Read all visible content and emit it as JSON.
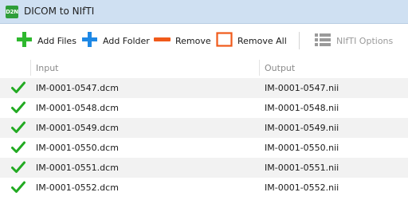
{
  "window": {
    "icon_text": "D2N",
    "title": "DICOM to NIfTI"
  },
  "toolbar": {
    "add_files_label": "Add Files",
    "add_folder_label": "Add Folder",
    "remove_label": "Remove",
    "remove_all_label": "Remove All",
    "nifti_options_label": "NIfTI Options",
    "colors": {
      "add": "#2eb82e",
      "folder": "#1e88e5",
      "remove": "#f05a1a",
      "disabled": "#9a9a9a"
    }
  },
  "list": {
    "columns": {
      "input": "Input",
      "output": "Output"
    },
    "status_icon": "check-icon",
    "status_color": "#22aa22",
    "rows": [
      {
        "input": "IM-0001-0547.dcm",
        "output": "IM-0001-0547.nii"
      },
      {
        "input": "IM-0001-0548.dcm",
        "output": "IM-0001-0548.nii"
      },
      {
        "input": "IM-0001-0549.dcm",
        "output": "IM-0001-0549.nii"
      },
      {
        "input": "IM-0001-0550.dcm",
        "output": "IM-0001-0550.nii"
      },
      {
        "input": "IM-0001-0551.dcm",
        "output": "IM-0001-0551.nii"
      },
      {
        "input": "IM-0001-0552.dcm",
        "output": "IM-0001-0552.nii"
      }
    ]
  }
}
